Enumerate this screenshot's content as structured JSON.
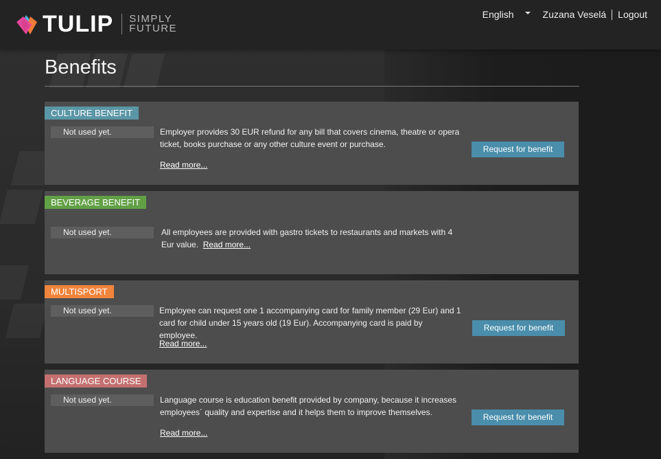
{
  "header": {
    "logo_word": "TULIP",
    "logo_tagline_1": "SIMPLY",
    "logo_tagline_2": "FUTURE",
    "language": "English",
    "user_name": "Zuzana Veselá",
    "logout_label": "Logout"
  },
  "page": {
    "title": "Benefits"
  },
  "colors": {
    "culture": "#5a96a6",
    "beverage": "#62a046",
    "multisport": "#f0843c",
    "language": "#c47070",
    "button": "#4a8eab"
  },
  "benefits": [
    {
      "title": "CULTURE BENEFIT",
      "status": "Not used yet.",
      "description": "Employer provides 30 EUR refund for any bill that covers cinema, theatre or opera ticket, books purchase or any other culture event or purchase.",
      "read_more": "Read more...",
      "button": "Request for benefit"
    },
    {
      "title": "BEVERAGE BENEFIT",
      "status": "Not used yet.",
      "description": "All employees are provided with gastro tickets to restaurants and markets with 4 Eur value.",
      "read_more": "Read more..."
    },
    {
      "title": "MULTISPORT",
      "status": "Not used yet.",
      "description": "Employee can request one 1 accompanying card for family member (29 Eur) and 1 card for child under 15 years old (19 Eur). Accompanying card is paid by employee.",
      "read_more": "Read more...",
      "button": "Request for benefit"
    },
    {
      "title": "LANGUAGE COURSE",
      "status": "Not used yet.",
      "description": "Language course is education benefit provided by company, because it increases employees´ quality and expertise and it helps them to improve themselves.",
      "read_more": "Read more...",
      "button": "Request for benefit"
    }
  ]
}
